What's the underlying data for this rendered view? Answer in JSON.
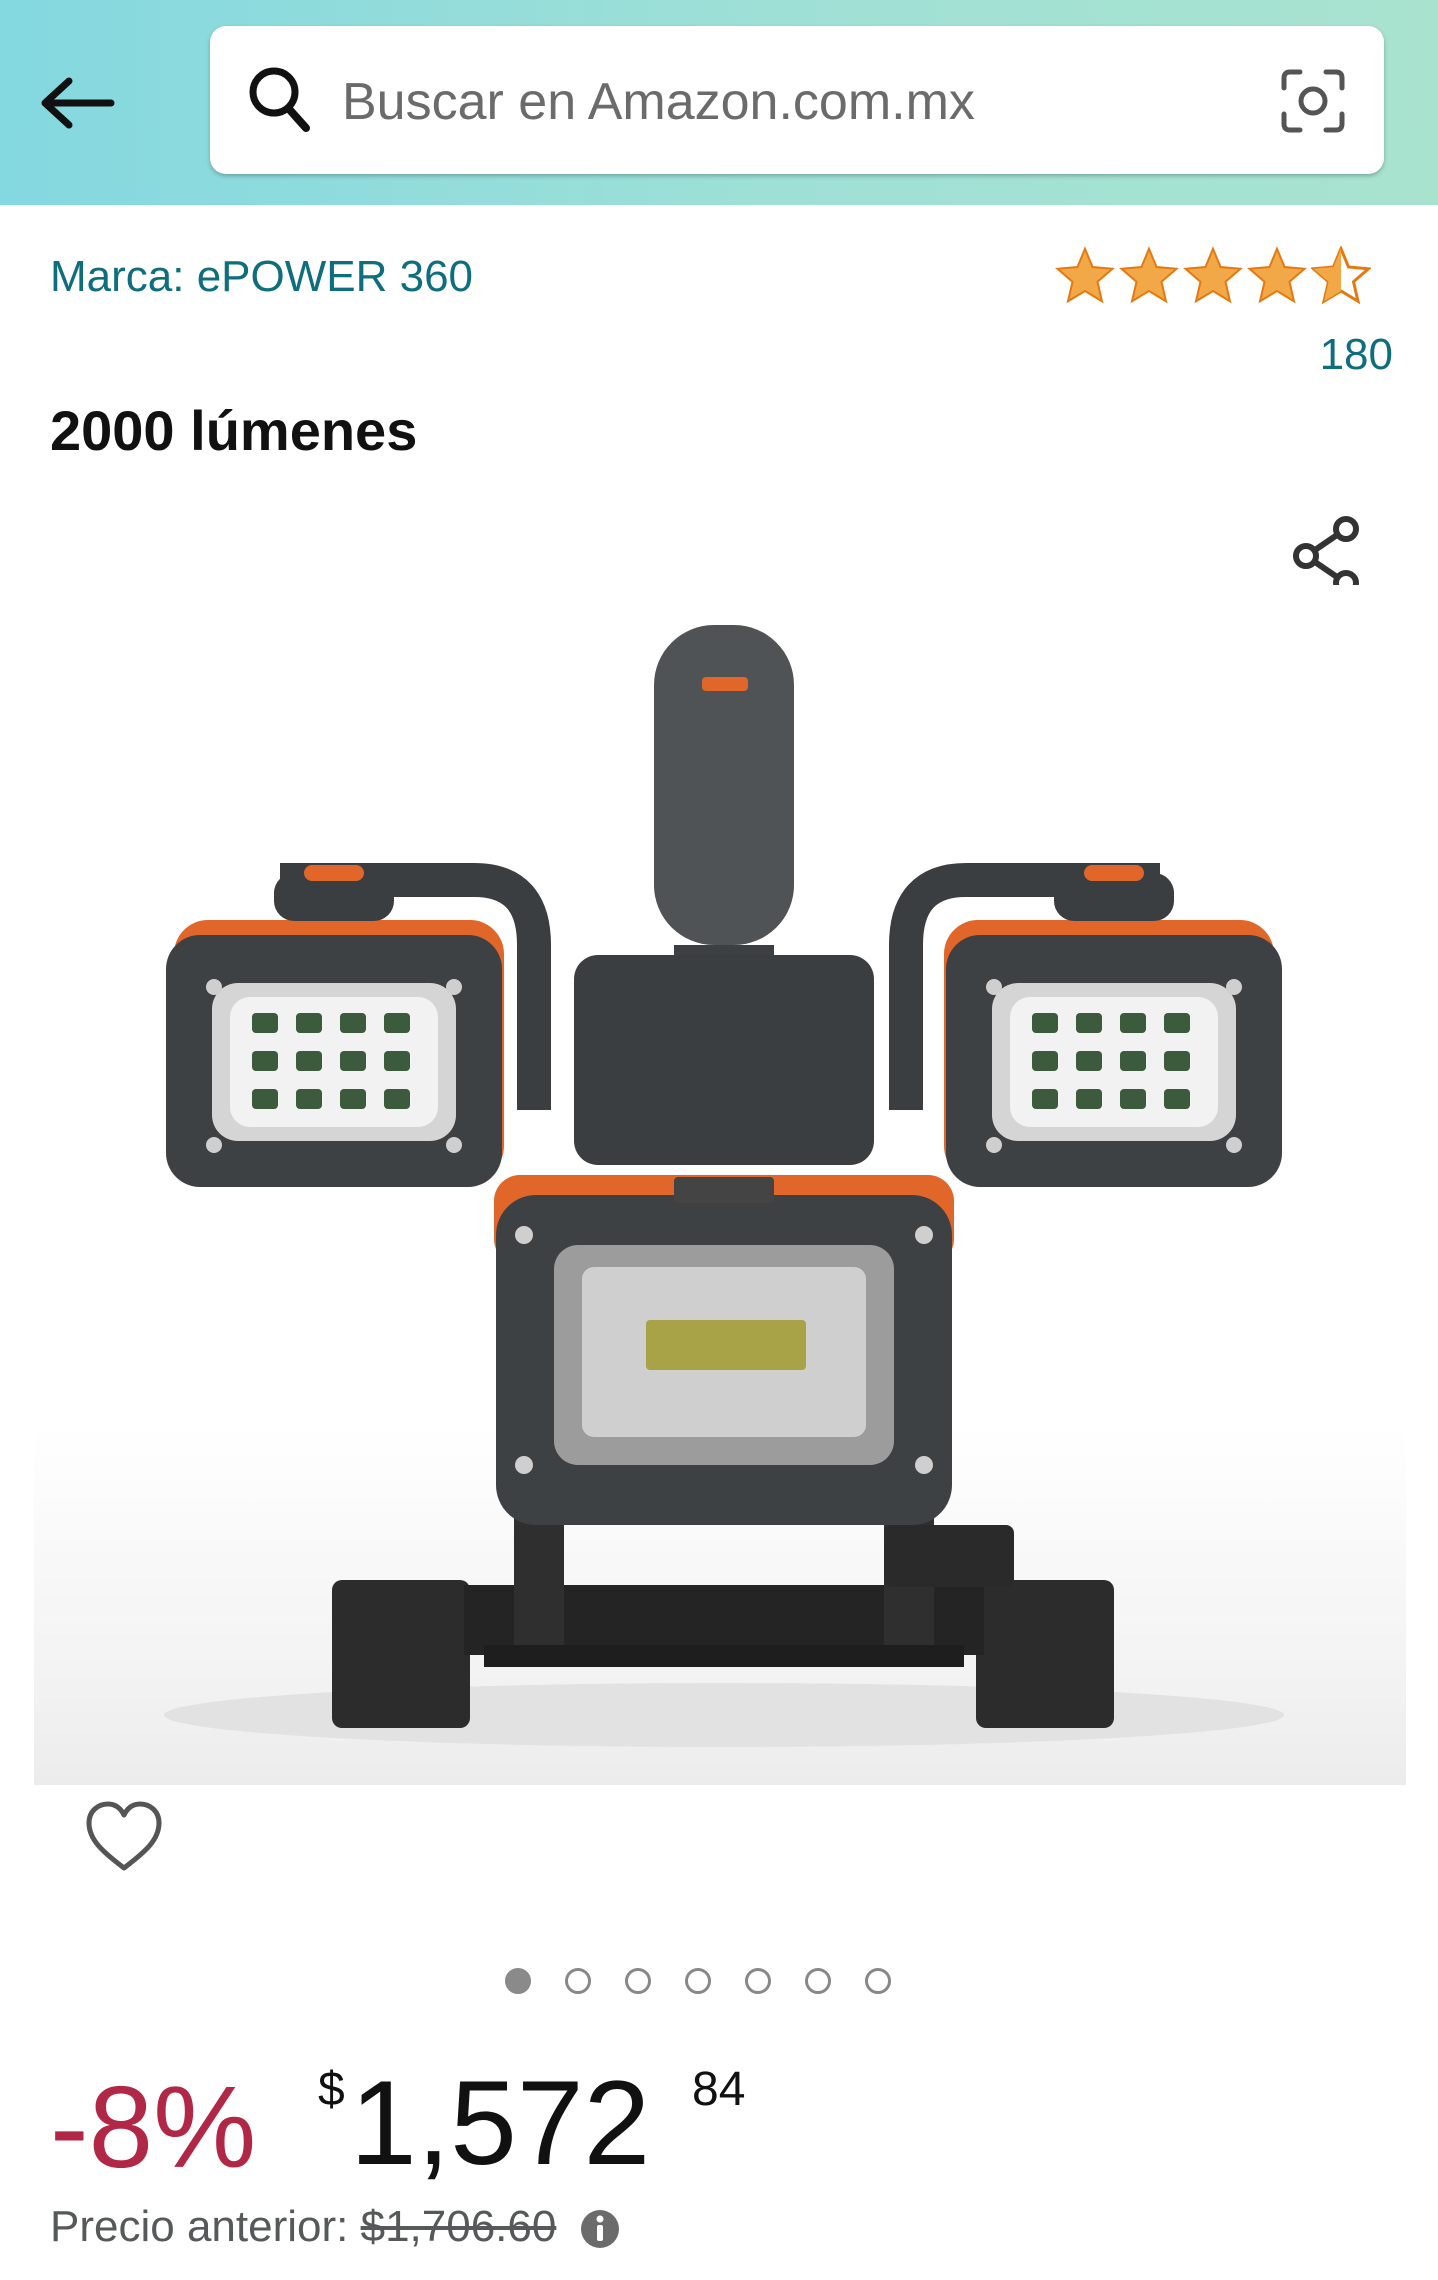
{
  "header": {
    "back_icon": "arrow-left-icon",
    "search": {
      "placeholder": "Buscar en Amazon.com.mx",
      "value": "",
      "left_icon": "search-icon",
      "right_icon": "camera-lens-icon"
    }
  },
  "product": {
    "brand_label": "Marca: ePOWER 360",
    "rating": {
      "stars": 4.5,
      "max": 5,
      "count": "180",
      "color": "#f3a847"
    },
    "title": "2000 lúmenes",
    "gallery": {
      "image_count": 7,
      "active_index": 0
    },
    "price": {
      "discount": "-8%",
      "currency": "$",
      "whole": "1,572",
      "cents": "84",
      "previous_label": "Precio anterior:",
      "previous_value": "$1,706.60"
    }
  },
  "colors": {
    "link": "#0f6e7d",
    "discount": "#b12746",
    "header_gradient_start": "#84d8e0",
    "header_gradient_end": "#a9e3cf"
  }
}
